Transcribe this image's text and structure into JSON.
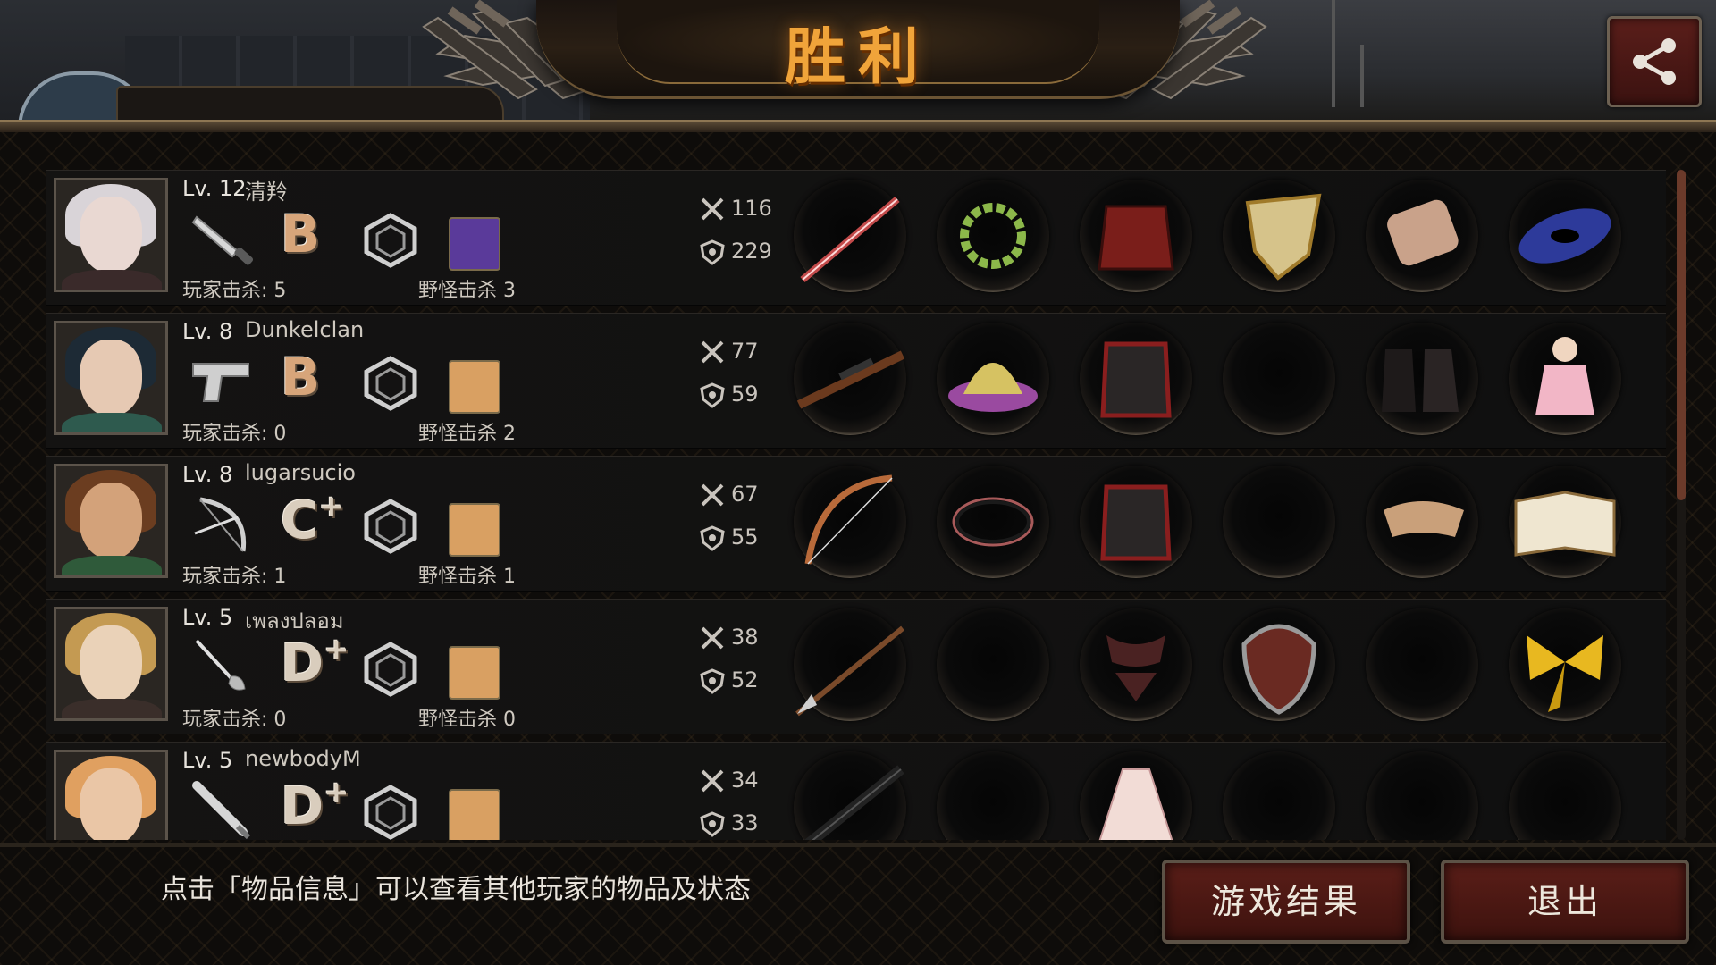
{
  "header": {
    "title": "胜利",
    "share_icon": "share-icon"
  },
  "players": [
    {
      "level": "Lv. 12",
      "name": "清羚",
      "grade": "B",
      "grade_plus": "",
      "weapon_icon": "knife-icon",
      "pk_label": "玩家击杀: 5",
      "mk_label": "野怪击杀 3",
      "attack": "116",
      "defense": "229",
      "portrait_colors": {
        "hair": "#d9d4d8",
        "face": "#e9d8d2",
        "body": "#3a2a2a"
      },
      "buff_color": "#5a3a9a",
      "items": [
        "crimson-sword",
        "laurel-wreath",
        "red-jacket",
        "golden-shield",
        "bandaged-gauntlet",
        "galaxy-orb"
      ]
    },
    {
      "level": "Lv. 8",
      "name": "Dunkelclan",
      "grade": "B",
      "grade_plus": "",
      "weapon_icon": "pistol-icon",
      "pk_label": "玩家击杀: 0",
      "mk_label": "野怪击杀 2",
      "attack": "77",
      "defense": "59",
      "portrait_colors": {
        "hair": "#1d2a35",
        "face": "#e6c9b3",
        "body": "#2e5a4e"
      },
      "buff_color": "#d9a062",
      "items": [
        "sniper-rifle",
        "yellow-hat",
        "black-red-armor",
        "empty",
        "floral-boots",
        "doll"
      ]
    },
    {
      "level": "Lv. 8",
      "name": "lugarsucio",
      "grade": "C",
      "grade_plus": "+",
      "weapon_icon": "bow-icon",
      "pk_label": "玩家击杀: 1",
      "mk_label": "野怪击杀 1",
      "attack": "67",
      "defense": "55",
      "portrait_colors": {
        "hair": "#6b3d20",
        "face": "#d3a27a",
        "body": "#2f5a3a"
      },
      "buff_color": "#d9a062",
      "items": [
        "longbow",
        "black-bracelet",
        "black-red-armor",
        "empty",
        "leather-sandals",
        "open-book"
      ]
    },
    {
      "level": "Lv. 5",
      "name": "เพลงปลอม",
      "grade": "D",
      "grade_plus": "+",
      "weapon_icon": "rapier-icon",
      "pk_label": "玩家击杀: 0",
      "mk_label": "野怪击杀 0",
      "attack": "38",
      "defense": "52",
      "portrait_colors": {
        "hair": "#c49a52",
        "face": "#ead2b8",
        "body": "#3a2e2a"
      },
      "buff_color": "#d9a062",
      "items": [
        "spear",
        "empty",
        "lingerie",
        "leather-shield",
        "empty",
        "gold-ribbon"
      ]
    },
    {
      "level": "Lv. 5",
      "name": "newbodyM",
      "grade": "D",
      "grade_plus": "+",
      "weapon_icon": "bat-icon",
      "pk_label": "",
      "mk_label": "",
      "attack": "34",
      "defense": "33",
      "portrait_colors": {
        "hair": "#e0a060",
        "face": "#eac6a6",
        "body": "#2a2020"
      },
      "buff_color": "#d9a062",
      "items": [
        "baton",
        "empty",
        "white-dress",
        "empty",
        "empty",
        "empty"
      ]
    }
  ],
  "footer": {
    "hint": "点击「物品信息」可以查看其他玩家的物品及状态",
    "result_button": "游戏结果",
    "exit_button": "退出"
  },
  "colors": {
    "title": "#f0a43a",
    "button_bg": "#4a1612",
    "panel_bg": "#101010"
  }
}
